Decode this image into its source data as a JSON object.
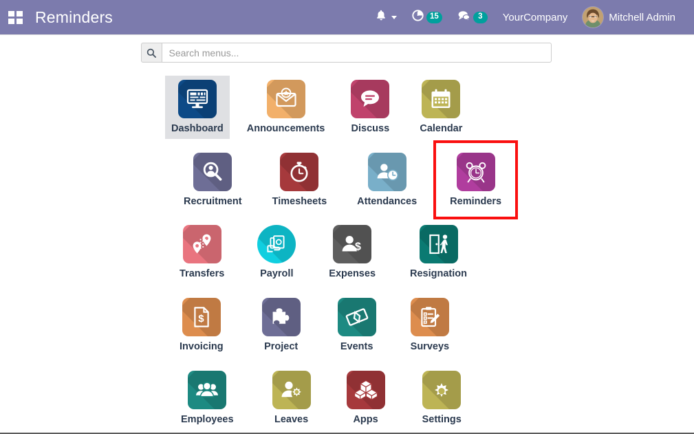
{
  "window": {
    "title": "Reminders"
  },
  "navbar": {
    "apps_icon": "grid-apps-icon",
    "brand_title": "Reminders",
    "activities": {
      "icon": "bell-icon",
      "caret": "chevron-down-icon"
    },
    "timer": {
      "icon": "clock-timer-icon",
      "count": "15"
    },
    "messages": {
      "icon": "chat-bubble-icon",
      "count": "3"
    },
    "company": "YourCompany",
    "user": {
      "avatar": "user-avatar",
      "name": "Mitchell Admin"
    },
    "accent_color": "#7c7bad",
    "badge_color": "#00a09d"
  },
  "search": {
    "icon": "search-icon",
    "value": "",
    "placeholder": "Search menus..."
  },
  "apps": {
    "selected": "Dashboard",
    "highlighted": "Reminders",
    "highlight_color": "#fa0f0f",
    "rows": [
      [
        {
          "label": "Dashboard",
          "icon": "dashboard-monitor-icon",
          "color": "#0d4a87",
          "selected": true
        },
        {
          "label": "Announcements",
          "icon": "envelope-star-icon",
          "color": "#f2b06a",
          "selected": false
        },
        {
          "label": "Discuss",
          "icon": "speech-bubble-icon",
          "color": "#c0436c",
          "selected": false
        },
        {
          "label": "Calendar",
          "icon": "calendar-icon",
          "color": "#bdb455",
          "selected": false
        }
      ],
      [
        {
          "label": "Recruitment",
          "icon": "magnifier-person-icon",
          "color": "#6e6e96",
          "selected": false
        },
        {
          "label": "Timesheets",
          "icon": "stopwatch-icon",
          "color": "#a6393c",
          "selected": false
        },
        {
          "label": "Attendances",
          "icon": "person-clock-icon",
          "color": "#79afc9",
          "selected": false
        },
        {
          "label": "Reminders",
          "icon": "alarm-clock-icon",
          "color": "#b03d9e",
          "selected": false
        }
      ],
      [
        {
          "label": "Transfers",
          "icon": "map-pins-icon",
          "color": "#e9747f",
          "selected": false
        },
        {
          "label": "Payroll",
          "icon": "money-hand-icon",
          "color": "#10cfe0",
          "selected": false,
          "shape": "circle"
        },
        {
          "label": "Expenses",
          "icon": "person-dollar-icon",
          "color": "#5e5e5e",
          "selected": false
        },
        {
          "label": "Resignation",
          "icon": "door-exit-icon",
          "color": "#0b7a72",
          "selected": false
        }
      ],
      [
        {
          "label": "Invoicing",
          "icon": "invoice-document-icon",
          "color": "#dd8d4e",
          "selected": false
        },
        {
          "label": "Project",
          "icon": "puzzle-piece-icon",
          "color": "#6e6e96",
          "selected": false
        },
        {
          "label": "Events",
          "icon": "ticket-icon",
          "color": "#1d8a82",
          "selected": false
        },
        {
          "label": "Surveys",
          "icon": "clipboard-pencil-icon",
          "color": "#dd8d4e",
          "selected": false
        }
      ],
      [
        {
          "label": "Employees",
          "icon": "people-group-icon",
          "color": "#1d8a82",
          "selected": false
        },
        {
          "label": "Leaves",
          "icon": "person-gear-icon",
          "color": "#bdb455",
          "selected": false
        },
        {
          "label": "Apps",
          "icon": "boxes-icon",
          "color": "#a6393c",
          "selected": false
        },
        {
          "label": "Settings",
          "icon": "gear-icon",
          "color": "#bdb455",
          "selected": false
        }
      ]
    ]
  }
}
